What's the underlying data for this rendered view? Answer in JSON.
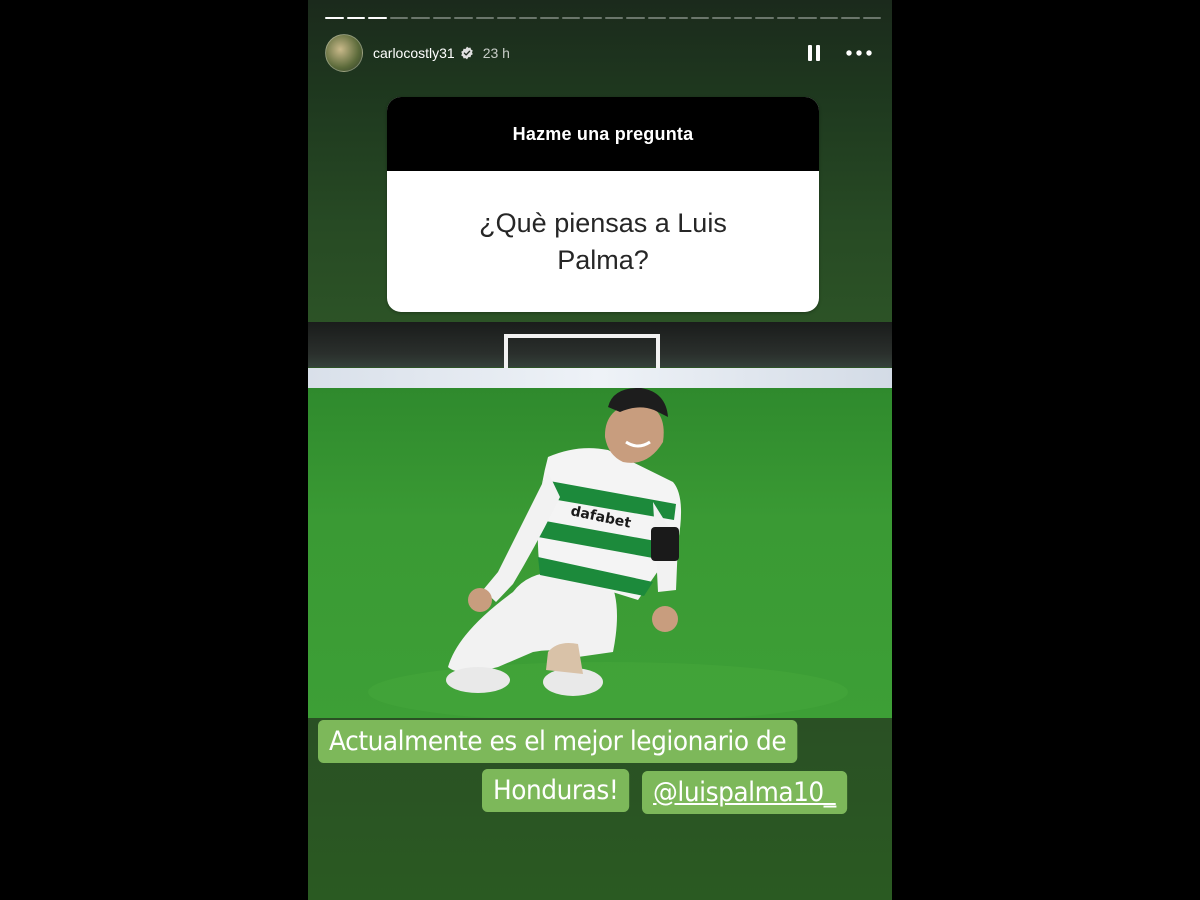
{
  "story": {
    "progress": {
      "total": 26,
      "completed": 3
    },
    "username": "carlocostly31",
    "time": "23 h",
    "icons": {
      "avatar": "profile-avatar",
      "verified": "verified-badge-icon",
      "pause": "pause-icon",
      "more": "more-options-icon"
    }
  },
  "question_sticker": {
    "header": "Hazme una pregunta",
    "question": "¿Què piensas a Luis Palma?"
  },
  "caption": {
    "line1": "Actualmente es el mejor legionario de",
    "line2": "Honduras!",
    "mention": "@luispalma10_"
  },
  "colors": {
    "caption_bg": "#7db85a",
    "sticker_header": "#000000",
    "sticker_body": "#ffffff"
  }
}
